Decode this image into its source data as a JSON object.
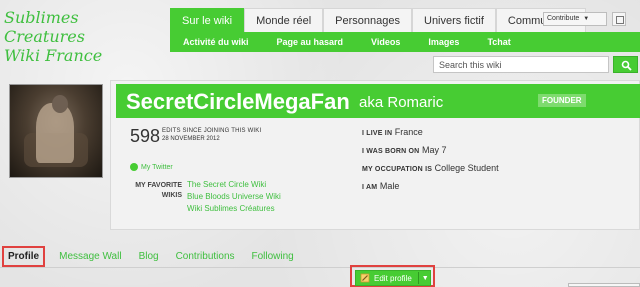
{
  "colors": {
    "accent": "#47cc33",
    "highlight": "#e0413f",
    "link": "#3fbf3f"
  },
  "logo": {
    "line1": "Sublimes Creatures",
    "line2": "Wiki France"
  },
  "topnav": {
    "tabs": [
      "Sur le wiki",
      "Monde réel",
      "Personnages",
      "Univers fictif",
      "Communauté"
    ],
    "active": "Sur le wiki"
  },
  "subnav": {
    "items": [
      "Activité du wiki",
      "Page au hasard",
      "Videos",
      "Images",
      "Tchat"
    ]
  },
  "header_tools": {
    "contribute_label": "Contribute"
  },
  "search": {
    "placeholder": "Search this wiki"
  },
  "profile": {
    "username": "SecretCircleMegaFan",
    "aka_label": "aka",
    "real_name": "Romaric",
    "badge": "FOUNDER",
    "edit_count": "598",
    "edits_label": "EDITS SINCE JOINING THIS WIKI",
    "joined_date": "28 NOVEMBER 2012",
    "details": [
      {
        "key": "I LIVE IN",
        "value": "France"
      },
      {
        "key": "I WAS BORN ON",
        "value": "May 7"
      },
      {
        "key": "MY OCCUPATION IS",
        "value": "College Student"
      },
      {
        "key": "I AM",
        "value": "Male"
      }
    ],
    "twitter_label": "My Twitter",
    "favorites_label_1": "MY FAVORITE",
    "favorites_label_2": "WIKIS",
    "favorite_wikis": [
      "The Secret Circle Wiki",
      "Blue Bloods Universe Wiki",
      "Wiki Sublimes Créatures"
    ]
  },
  "profile_tabs": {
    "items": [
      "Profile",
      "Message Wall",
      "Blog",
      "Contributions",
      "Following"
    ],
    "active": "Profile"
  },
  "edit_profile": {
    "label": "Edit profile"
  }
}
